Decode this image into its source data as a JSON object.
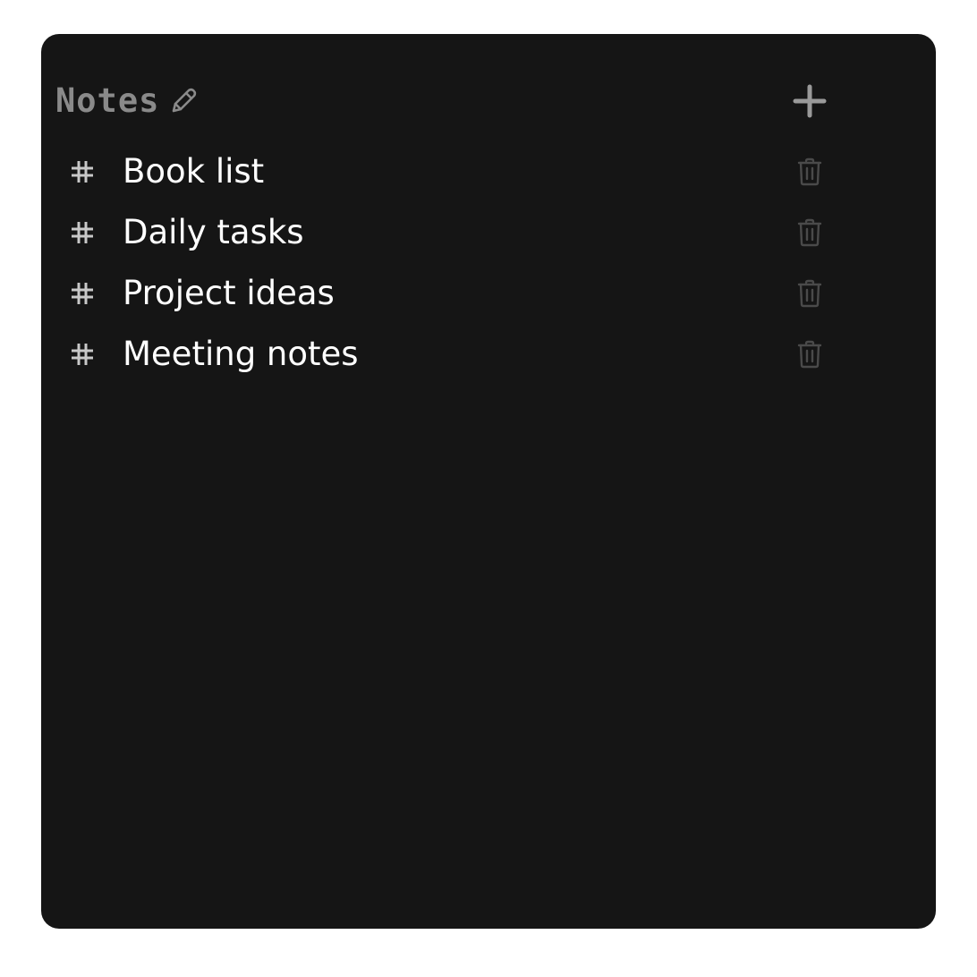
{
  "header": {
    "title": "Notes",
    "edit_icon": "pencil-icon",
    "add_icon": "plus-icon"
  },
  "notes": [
    {
      "label": "Book list",
      "icon": "hash-icon",
      "action_icon": "trash-icon"
    },
    {
      "label": "Daily tasks",
      "icon": "hash-icon",
      "action_icon": "trash-icon"
    },
    {
      "label": "Project ideas",
      "icon": "hash-icon",
      "action_icon": "trash-icon"
    },
    {
      "label": "Meeting notes",
      "icon": "hash-icon",
      "action_icon": "trash-icon"
    }
  ],
  "colors": {
    "panel_background": "#151515",
    "page_background": "#ffffff",
    "title_text": "#8a8a8a",
    "note_text": "#ffffff",
    "hash_icon": "#c8c8c8",
    "trash_icon": "#4a4a4a",
    "add_icon": "#9a9a9a"
  }
}
